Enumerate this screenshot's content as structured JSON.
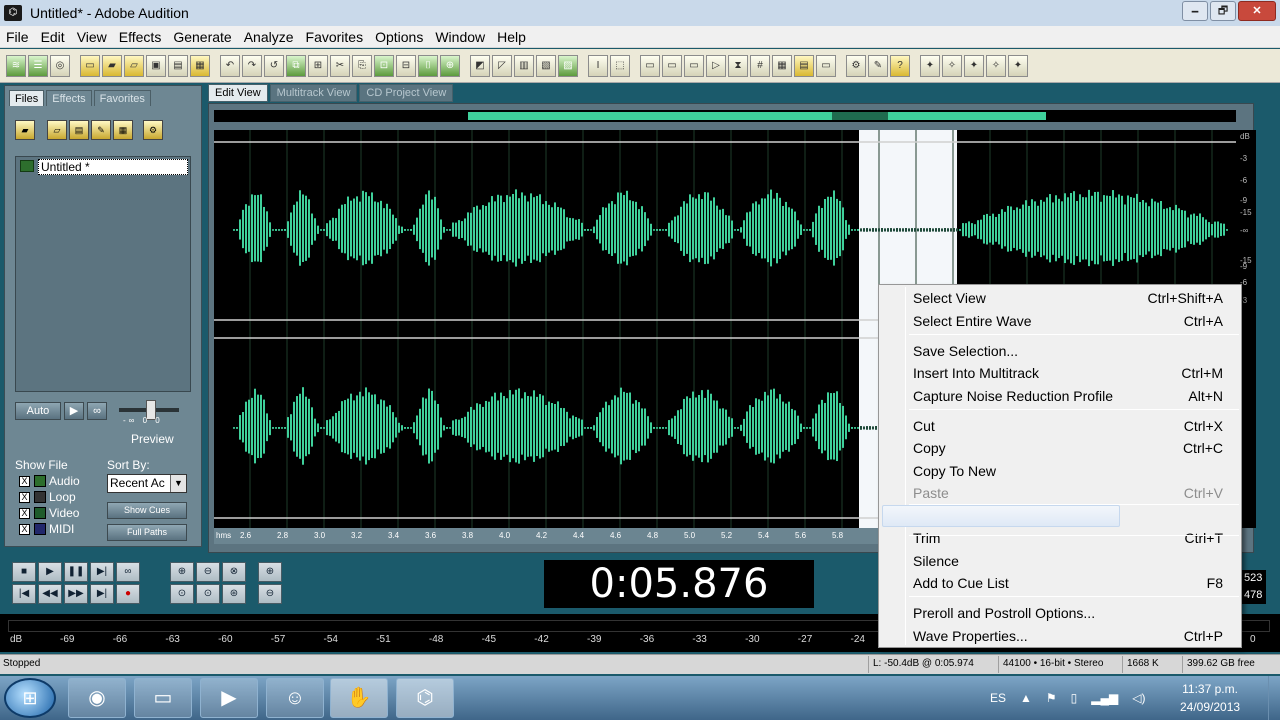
{
  "window": {
    "title": "Untitled* - Adobe Audition",
    "minimize": "🗕",
    "restore": "🗗",
    "close": "✕"
  },
  "menu": [
    "File",
    "Edit",
    "View",
    "Effects",
    "Generate",
    "Analyze",
    "Favorites",
    "Options",
    "Window",
    "Help"
  ],
  "left_panel": {
    "tabs": [
      "Files",
      "Effects",
      "Favorites"
    ],
    "file_item": "Untitled *",
    "auto_label": "Auto",
    "play_label": "▶",
    "loop_label": "∞",
    "preview_label": "Preview",
    "show_file_label": "Show File",
    "sort_by_label": "Sort By:",
    "filters": [
      {
        "label": "Audio",
        "checked": "X"
      },
      {
        "label": "Loop",
        "checked": "X"
      },
      {
        "label": "Video",
        "checked": "X"
      },
      {
        "label": "MIDI",
        "checked": "X"
      }
    ],
    "sort_value": "Recent Ac",
    "show_cues": "Show Cues",
    "full_paths": "Full Paths"
  },
  "view_tabs": [
    "Edit View",
    "Multitrack View",
    "CD Project View"
  ],
  "time_ruler": [
    "hms",
    "2.6",
    "2.8",
    "3.0",
    "3.2",
    "3.4",
    "3.6",
    "3.8",
    "4.0",
    "4.2",
    "4.4",
    "4.6",
    "4.8",
    "5.0",
    "5.2",
    "5.4",
    "5.6",
    "5.8"
  ],
  "db_scale": [
    "dB",
    "-3",
    "-6",
    "-9",
    "-15",
    "-∞",
    "-15",
    "-9",
    "-6",
    "-3"
  ],
  "time_display": "0:05.876",
  "selection_info": [
    "523",
    "478"
  ],
  "meter": {
    "labels": [
      "dB",
      "-69",
      "-66",
      "-63",
      "-60",
      "-57",
      "-54",
      "-51",
      "-48",
      "-45",
      "-42",
      "-39",
      "-36",
      "-33",
      "-30",
      "-27",
      "-24",
      "-21",
      "0"
    ]
  },
  "status": {
    "state": "Stopped",
    "level": "L: -50.4dB @ 0:05.974",
    "format": "44100 • 16-bit • Stereo",
    "size": "1668 K",
    "free": "399.62 GB free"
  },
  "context_menu": [
    {
      "label": "Select View",
      "shortcut": "Ctrl+Shift+A",
      "enabled": true
    },
    {
      "label": "Select Entire Wave",
      "shortcut": "Ctrl+A",
      "enabled": true
    },
    {
      "label": "Save Selection...",
      "shortcut": "",
      "enabled": true
    },
    {
      "label": "Insert Into Multitrack",
      "shortcut": "Ctrl+M",
      "enabled": true
    },
    {
      "label": "Capture Noise Reduction Profile",
      "shortcut": "Alt+N",
      "enabled": true
    },
    {
      "label": "Cut",
      "shortcut": "Ctrl+X",
      "enabled": true
    },
    {
      "label": "Copy",
      "shortcut": "Ctrl+C",
      "enabled": true
    },
    {
      "label": "Copy To New",
      "shortcut": "",
      "enabled": true
    },
    {
      "label": "Paste",
      "shortcut": "Ctrl+V",
      "enabled": false
    },
    {
      "label": "Trim",
      "shortcut": "Ctrl+T",
      "enabled": true
    },
    {
      "label": "Silence",
      "shortcut": "",
      "enabled": true
    },
    {
      "label": "Add to Cue List",
      "shortcut": "F8",
      "enabled": true
    },
    {
      "label": "Preroll and Postroll Options...",
      "shortcut": "",
      "enabled": true
    },
    {
      "label": "Wave Properties...",
      "shortcut": "Ctrl+P",
      "enabled": true
    }
  ],
  "taskbar": {
    "start_icon": "windows-logo-icon",
    "items": [
      "chrome-icon",
      "explorer-folder-icon",
      "media-player-icon",
      "contacts-icon",
      "audition-icon",
      "app-icon"
    ],
    "lang": "ES",
    "time": "11:37 p.m.",
    "date": "24/09/2013"
  },
  "colors": {
    "waveform": "#3fd09b",
    "background": "#1b5a6b",
    "selection": "#f4f7fa"
  }
}
